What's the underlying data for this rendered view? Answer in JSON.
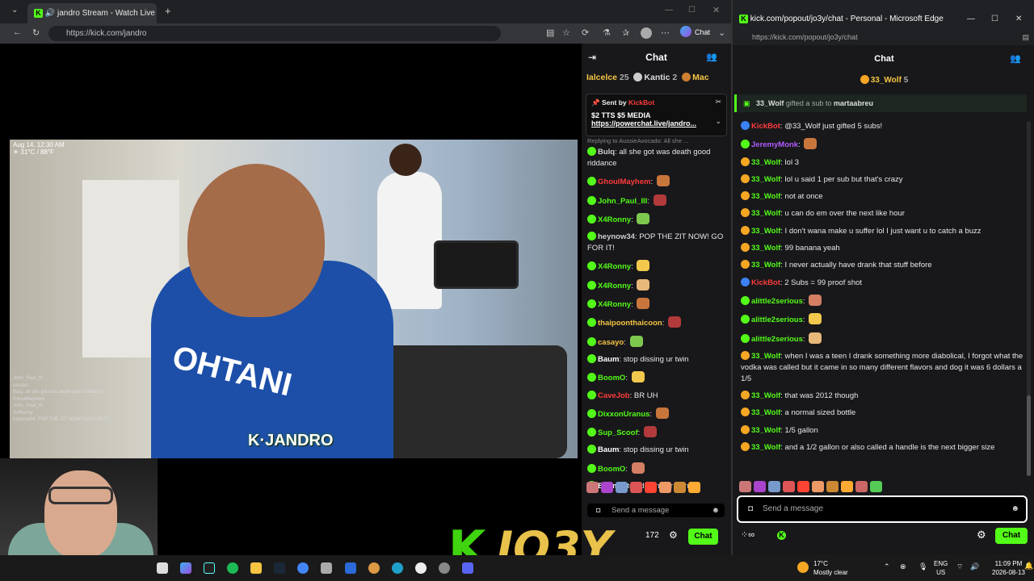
{
  "left_browser": {
    "tab_title": "jandro Stream - Watch Live o",
    "url": "https://kick.com/jandro",
    "chat_button": "Chat"
  },
  "stream": {
    "overlay_date": "Aug 14, 12:30 AM",
    "overlay_temp": "☀ 31°C / 88°F",
    "logo_text": "K·JANDRO",
    "shirt_text": "OHTANI",
    "overlay_chat": [
      "John_Paul_III",
      "casayo",
      "Bulq: all she got was death good riddance",
      "GhoulMayhem",
      "John_Paul_III",
      "X4Ronny",
      "heynow34: POP THE ZIT NOW! GO FOR IT!"
    ]
  },
  "left_chat": {
    "header": "Chat",
    "leaderboard": [
      {
        "name": "Ialcelce",
        "count": "25"
      },
      {
        "name": "Kantic",
        "count": "2"
      },
      {
        "name": "Mac",
        "count": ""
      }
    ],
    "pinned": {
      "sent_by_label": "Sent by",
      "sender": "KickBot",
      "tts": "$2 TTS $5 MEDIA",
      "link": "https://powerchat.live/jandro..."
    },
    "reply_hint": "Replying to AussieAvocado: All she ...",
    "messages": [
      {
        "user": "Bulq",
        "color": "#cfcfcf",
        "text": "all she got was death good riddance"
      },
      {
        "user": "GhoulMayhem",
        "color": "#ff3b3b",
        "text": ""
      },
      {
        "user": "John_Paul_III",
        "color": "#53fc18",
        "text": ""
      },
      {
        "user": "X4Ronny",
        "color": "#53fc18",
        "text": ""
      },
      {
        "user": "heynow34",
        "color": "#cfcfcf",
        "text": "POP THE ZIT NOW! GO FOR IT!"
      },
      {
        "user": "X4Ronny",
        "color": "#53fc18",
        "text": ""
      },
      {
        "user": "X4Ronny",
        "color": "#53fc18",
        "text": ""
      },
      {
        "user": "X4Ronny",
        "color": "#53fc18",
        "text": ""
      },
      {
        "user": "thaipoonthaicoon",
        "color": "#f5c542",
        "text": ""
      },
      {
        "user": "casayo",
        "color": "#f5c542",
        "text": ""
      },
      {
        "user": "Baum",
        "color": "#ffffff",
        "text": "stop dissing ur twin"
      },
      {
        "user": "BoomO",
        "color": "#53fc18",
        "text": ""
      },
      {
        "user": "CaveJob",
        "color": "#ff3b3b",
        "text": "BR UH"
      },
      {
        "user": "DixxonUranus",
        "color": "#53fc18",
        "text": ""
      },
      {
        "user": "Sup_Scoof",
        "color": "#53fc18",
        "text": ""
      },
      {
        "user": "Baum",
        "color": "#ffffff",
        "text": "stop dissing ur twin"
      },
      {
        "user": "BoomO",
        "color": "#53fc18",
        "text": ""
      },
      {
        "user": "Baum",
        "color": "#ffffff",
        "text": "stop dissing ur twin"
      }
    ],
    "send_placeholder": "Send a message",
    "viewers": "172",
    "chat_button": "Chat"
  },
  "right_window": {
    "title": "kick.com/popout/jo3y/chat - Personal - Microsoft Edge",
    "url": "https://kick.com/popout/jo3y/chat",
    "header": "Chat",
    "top_gifter": {
      "name": "33_Wolf",
      "count": "5"
    },
    "gift_banner": {
      "user": "33_Wolf",
      "action": "gifted a sub to",
      "target": "martaabreu"
    },
    "messages": [
      {
        "user": "KickBot",
        "color": "#ff3b3b",
        "text": "@33_Wolf just gifted 5 subs!"
      },
      {
        "user": "JeremyMonk",
        "color": "#b05cff",
        "text": ""
      },
      {
        "user": "33_Wolf",
        "color": "#53fc18",
        "text": "lol 3"
      },
      {
        "user": "33_Wolf",
        "color": "#53fc18",
        "text": "lol u said 1 per sub but that's crazy"
      },
      {
        "user": "33_Wolf",
        "color": "#53fc18",
        "text": "not at once"
      },
      {
        "user": "33_Wolf",
        "color": "#53fc18",
        "text": "u can do em over the next like hour"
      },
      {
        "user": "33_Wolf",
        "color": "#53fc18",
        "text": "I don't wana make u suffer lol I just want u to catch a buzz"
      },
      {
        "user": "33_Wolf",
        "color": "#53fc18",
        "text": "99 banana yeah"
      },
      {
        "user": "33_Wolf",
        "color": "#53fc18",
        "text": "I never actually have drank that stuff before"
      },
      {
        "user": "KickBot",
        "color": "#ff3b3b",
        "text": "2 Subs = 99 proof shot"
      },
      {
        "user": "alittle2serious",
        "color": "#53fc18",
        "text": ""
      },
      {
        "user": "alittle2serious",
        "color": "#53fc18",
        "text": ""
      },
      {
        "user": "alittle2serious",
        "color": "#53fc18",
        "text": ""
      },
      {
        "user": "33_Wolf",
        "color": "#53fc18",
        "text": "when I was a teen I drank something more diabolical, I forgot what the vodka was called but it came in so many different flavors and dog it was 6 dollars a 1/5"
      },
      {
        "user": "33_Wolf",
        "color": "#53fc18",
        "text": "that was 2012 though"
      },
      {
        "user": "33_Wolf",
        "color": "#53fc18",
        "text": "a normal sized bottle"
      },
      {
        "user": "33_Wolf",
        "color": "#53fc18",
        "text": "1/5 gallon"
      },
      {
        "user": "33_Wolf",
        "color": "#53fc18",
        "text": "and a 1/2 gallon or also called a handle is the next bigger size"
      }
    ],
    "send_placeholder": "Send a message",
    "chat_button": "Chat"
  },
  "taskbar": {
    "weather_temp": "17°C",
    "weather_desc": "Mostly clear",
    "lang": "ENG",
    "region": "US",
    "time": "11:09 PM",
    "date": "2026-08-13"
  },
  "brand_overlay": "JO3Y"
}
